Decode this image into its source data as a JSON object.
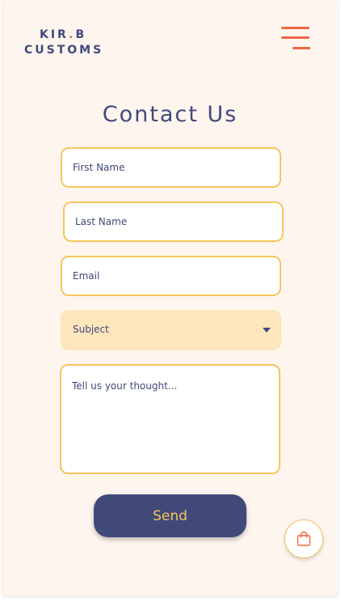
{
  "brand": {
    "line1_a": "KIR",
    "line1_dot": ".",
    "line1_b": "B",
    "line2": "CUSTOMS"
  },
  "header": {
    "menu_icon": "hamburger-menu-icon"
  },
  "page": {
    "title": "Contact Us"
  },
  "form": {
    "first_name_placeholder": "First Name",
    "last_name_placeholder": "Last Name",
    "email_placeholder": "Email",
    "subject_label": "Subject",
    "message_placeholder": "Tell us your thought...",
    "send_label": "Send"
  },
  "cart": {
    "icon": "shopping-bag-icon"
  },
  "colors": {
    "navy": "#40497a",
    "accent_orange": "#f06543",
    "field_border": "#f6c65b",
    "select_bg": "#fde6bc",
    "page_bg": "#fff5ef"
  }
}
